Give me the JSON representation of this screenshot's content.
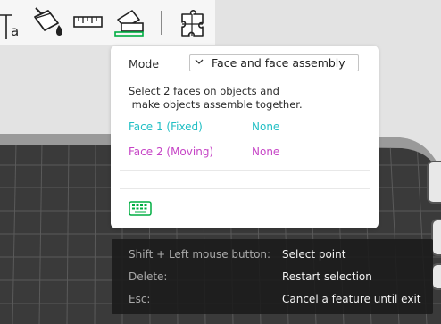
{
  "toolbar": {
    "tools": [
      {
        "icon": "text-tool-icon"
      },
      {
        "icon": "paint-bucket-icon"
      },
      {
        "icon": "ruler-icon"
      },
      {
        "icon": "assembly-icon",
        "active": true
      },
      {
        "icon": "puzzle-icon"
      }
    ],
    "accent_color": "#00ae42"
  },
  "panel": {
    "mode_label": "Mode",
    "mode_value": "Face and face assembly",
    "instructions": "Select 2 faces on objects and\n make objects assemble together.",
    "face1_label": "Face 1 (Fixed)",
    "face1_value": "None",
    "face1_color": "#21bfc4",
    "face2_label": "Face 2 (Moving)",
    "face2_value": "None",
    "face2_color": "#c644c6",
    "keyboard_icon": "keyboard-icon"
  },
  "shortcuts": [
    {
      "keys": "Shift + Left mouse button:",
      "action": "Select point"
    },
    {
      "keys": "Delete:",
      "action": "Restart selection"
    },
    {
      "keys": "Esc:",
      "action": "Cancel a feature until exit"
    }
  ]
}
